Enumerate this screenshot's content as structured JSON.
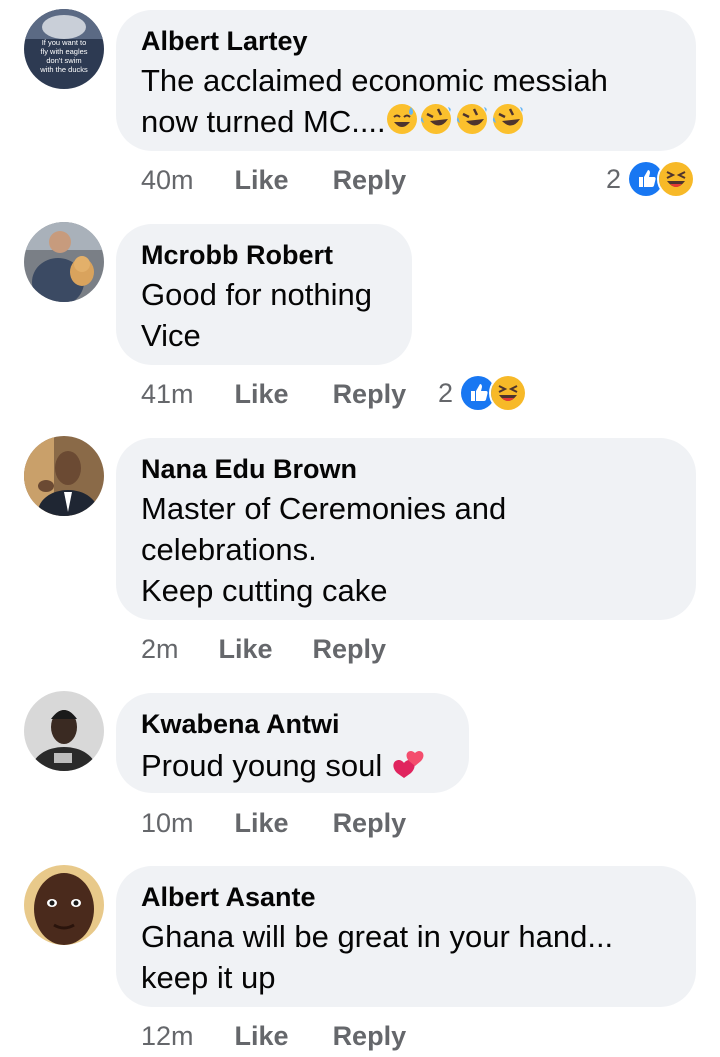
{
  "comments": [
    {
      "author": "Albert Lartey",
      "text": "The acclaimed economic messiah\nnow turned MC....",
      "emojis": [
        "sweat-smile",
        "rofl",
        "rofl",
        "rofl"
      ],
      "time": "40m",
      "like_label": "Like",
      "reply_label": "Reply",
      "reaction_count": "2",
      "reactions": [
        "like",
        "haha"
      ],
      "avatar_caption": "If you want to fly with eagles don't swim with the ducks"
    },
    {
      "author": "Mcrobb Robert",
      "text": "Good for nothing\nVice",
      "emojis": [],
      "time": "41m",
      "like_label": "Like",
      "reply_label": "Reply",
      "reaction_count": "2",
      "reactions": [
        "like",
        "haha"
      ]
    },
    {
      "author": "Nana Edu Brown",
      "text": "Master of Ceremonies and\ncelebrations.\nKeep cutting cake",
      "emojis": [],
      "time": "2m",
      "like_label": "Like",
      "reply_label": "Reply"
    },
    {
      "author": "Kwabena Antwi",
      "text": "Proud young soul ",
      "emojis": [
        "two-hearts"
      ],
      "time": "10m",
      "like_label": "Like",
      "reply_label": "Reply"
    },
    {
      "author": "Albert Asante",
      "text": "Ghana will be great in your hand...\nkeep it up",
      "emojis": [],
      "time": "12m",
      "like_label": "Like",
      "reply_label": "Reply"
    }
  ],
  "colors": {
    "bubble": "#f0f2f5",
    "secondary_text": "#65676b",
    "like_blue": "#1877f2",
    "haha_yellow": "#f7b928"
  }
}
